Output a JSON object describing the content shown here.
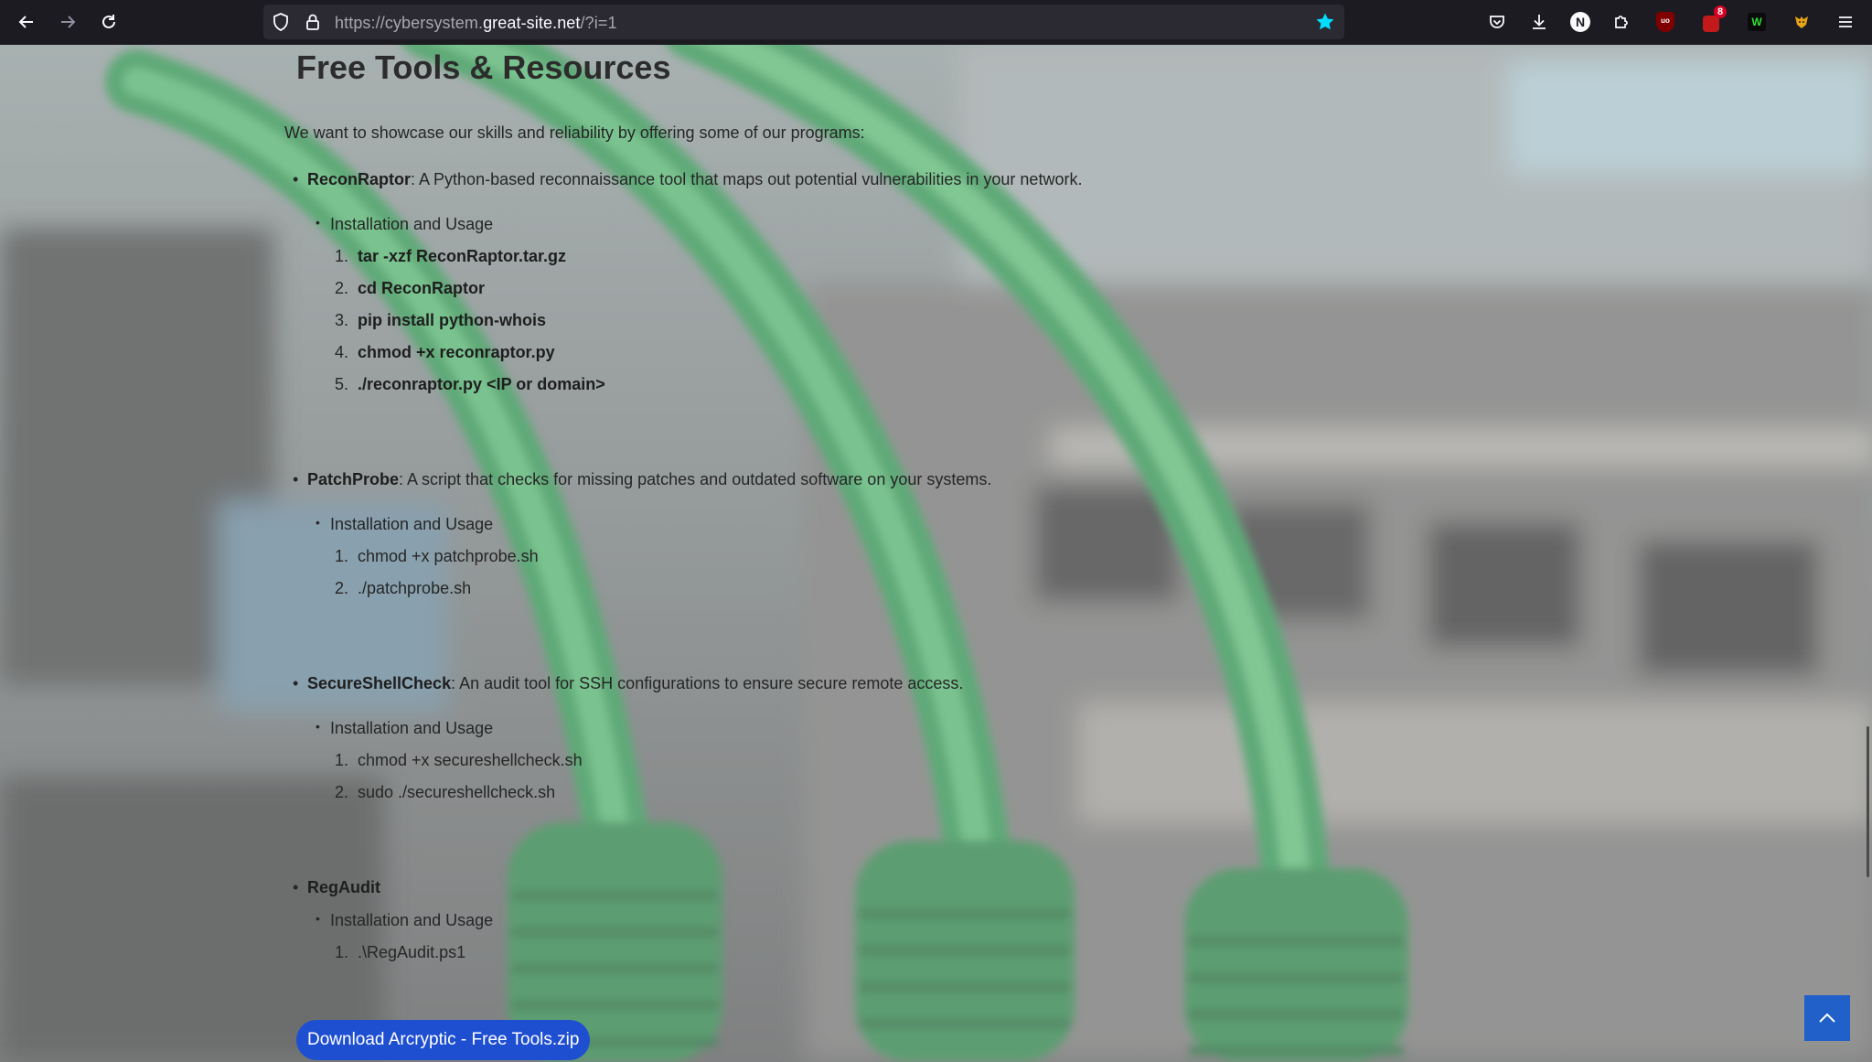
{
  "browser": {
    "url_prefix": "https://cybersystem.",
    "url_domain": "great-site.net",
    "url_suffix": "/?i=1",
    "back_icon": "arrow-left-icon",
    "forward_icon": "arrow-right-icon",
    "reload_icon": "reload-icon",
    "bookmark_icon": "star-icon",
    "extensions": [
      {
        "name": "pocket-icon"
      },
      {
        "name": "download-icon"
      },
      {
        "name": "notion-icon",
        "label": "N"
      },
      {
        "name": "puzzle-icon"
      },
      {
        "name": "ublock-icon",
        "label": "uo"
      },
      {
        "name": "addon-icon",
        "badge": "8"
      },
      {
        "name": "w-extension-icon",
        "label": "W"
      },
      {
        "name": "fox-icon"
      }
    ],
    "menu_icon": "hamburger-menu-icon",
    "accent": "#00ddff"
  },
  "page": {
    "title": "Free Tools & Resources",
    "intro": "We want to showcase our skills and reliability by offering some of our programs:",
    "tools": [
      {
        "name": "ReconRaptor",
        "description": ": A Python-based reconnaissance tool that maps out potential vulnerabilities in your network.",
        "sub": "Installation and Usage",
        "steps": [
          "tar -xzf ReconRaptor.tar.gz",
          "cd ReconRaptor",
          "pip install python-whois",
          "chmod +x reconraptor.py",
          "./reconraptor.py <IP or domain>"
        ]
      },
      {
        "name": "PatchProbe",
        "description": ": A script that checks for missing patches and outdated software on your systems.",
        "sub": "Installation and Usage",
        "steps": [
          "chmod +x patchprobe.sh",
          "./patchprobe.sh"
        ]
      },
      {
        "name": "SecureShellCheck",
        "description": ": An audit tool for SSH configurations to ensure secure remote access.",
        "sub": "Installation and Usage",
        "steps": [
          "chmod +x secureshellcheck.sh",
          "sudo ./secureshellcheck.sh"
        ]
      },
      {
        "name": "RegAudit",
        "description": "",
        "sub": "Installation and Usage",
        "steps": [
          ".\\RegAudit.ps1"
        ]
      }
    ],
    "download_button": "Download Arcryptic - Free Tools.zip",
    "back_to_top_icon": "chevron-up-icon",
    "button_color": "#1f4fd1"
  }
}
